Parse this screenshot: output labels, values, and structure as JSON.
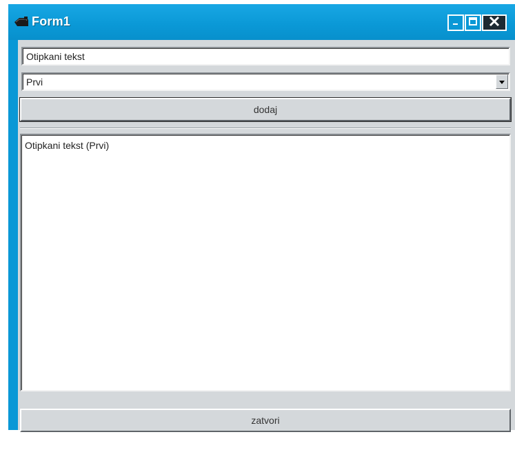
{
  "window": {
    "title": "Form1",
    "controls": {
      "minimize_icon": "minimize-icon",
      "maximize_icon": "maximize-icon",
      "close_icon": "close-icon"
    },
    "title_color": "#0a98d6"
  },
  "form": {
    "text_input": {
      "value": "Otipkani tekst"
    },
    "combo": {
      "selected": "Prvi"
    },
    "add_button": {
      "label": "dodaj"
    },
    "list": {
      "items": [
        "Otipkani tekst (Prvi)"
      ]
    },
    "close_button": {
      "label": "zatvori"
    }
  }
}
